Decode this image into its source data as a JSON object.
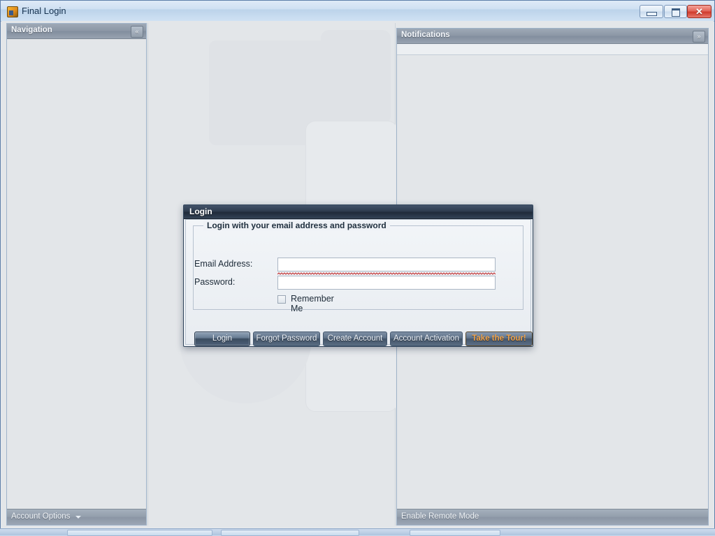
{
  "window": {
    "title": "Final Login",
    "app_icon": "app-icon",
    "controls": {
      "minimize_label": "",
      "maximize_label": "",
      "close_label": "✕"
    }
  },
  "navigation_dock": {
    "title": "Navigation",
    "collapse_label": "«",
    "footer_label": "Account Options"
  },
  "notifications_dock": {
    "title": "Notifications",
    "expand_label": "»",
    "footer_label": "Enable Remote Mode"
  },
  "login_dialog": {
    "title": "Login",
    "group_legend": "Login with your email address and password",
    "fields": [
      {
        "label": "Email Address:",
        "value": "",
        "placeholder": "",
        "invalid": true
      },
      {
        "label": "Password:",
        "value": "",
        "placeholder": "",
        "invalid": false
      }
    ],
    "remember_me": {
      "label": "Remember Me",
      "checked": false
    },
    "buttons": [
      {
        "label": "Login",
        "style": "default"
      },
      {
        "label": "Forgot Password",
        "style": "normal"
      },
      {
        "label": "Create Account",
        "style": "normal"
      },
      {
        "label": "Account Activation",
        "style": "normal"
      },
      {
        "label": "Take the Tour!",
        "style": "accent"
      }
    ]
  },
  "colors": {
    "accent_orange": "#f0a24a",
    "dialog_title_bg": "#2e3c4f",
    "dock_header_bg": "#8c97a6",
    "close_button_red": "#cf3a2c",
    "error_squiggle": "#c02a2a",
    "window_bg": "#e3e6e9"
  }
}
